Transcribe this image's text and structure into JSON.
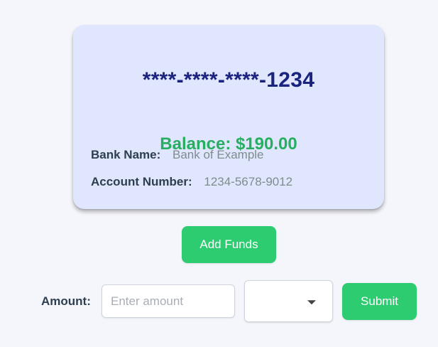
{
  "card": {
    "masked_number": "****-****-****-1234",
    "balance": "Balance: $190.00",
    "bank_name_label": "Bank Name:",
    "bank_name_value": "Bank of Example",
    "account_number_label": "Account Number:",
    "account_number_value": "1234-5678-9012"
  },
  "actions": {
    "add_funds_label": "Add Funds"
  },
  "form": {
    "amount_label": "Amount:",
    "amount_value": "",
    "amount_placeholder": "Enter amount",
    "select_value": "",
    "select_caret_icon": "chevron-down-icon",
    "submit_label": "Submit"
  },
  "colors": {
    "background": "#f5f6fb",
    "card_background": "#e0e6fd",
    "card_number": "#1a237e",
    "balance": "#27ae60",
    "button": "#2ecc71"
  }
}
